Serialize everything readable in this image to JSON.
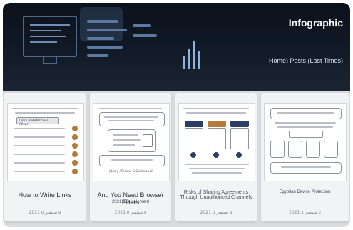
{
  "hero": {
    "title": "Infographic",
    "breadcrumb": "Home) Posts (Last Times)"
  },
  "cards": [
    {
      "title": "How to Write Links",
      "meta": "2021 ٥ سبتمبر ٥",
      "thumb_button": "Learn in Perfectness (Blogs)"
    },
    {
      "title": "And You Need Browser Filters",
      "subtitle": "2021 A Supplement",
      "meta": "2021 ٥ سبتمبر ٥",
      "thumb_caption": "jQuery / Browse & Guidance UI"
    },
    {
      "title": "Risks of Sharing Agreements Through Unauthorized Channels",
      "meta": "2021 ٥ سبتمبر ٥"
    },
    {
      "title": "Egyptian Device Protection",
      "meta": "2021 ٥ سبتمبر ٥"
    }
  ],
  "colors": {
    "hero_bg": "#0c111b",
    "brand_navy": "#2c3e66",
    "accent_orange": "#b47a3c"
  }
}
